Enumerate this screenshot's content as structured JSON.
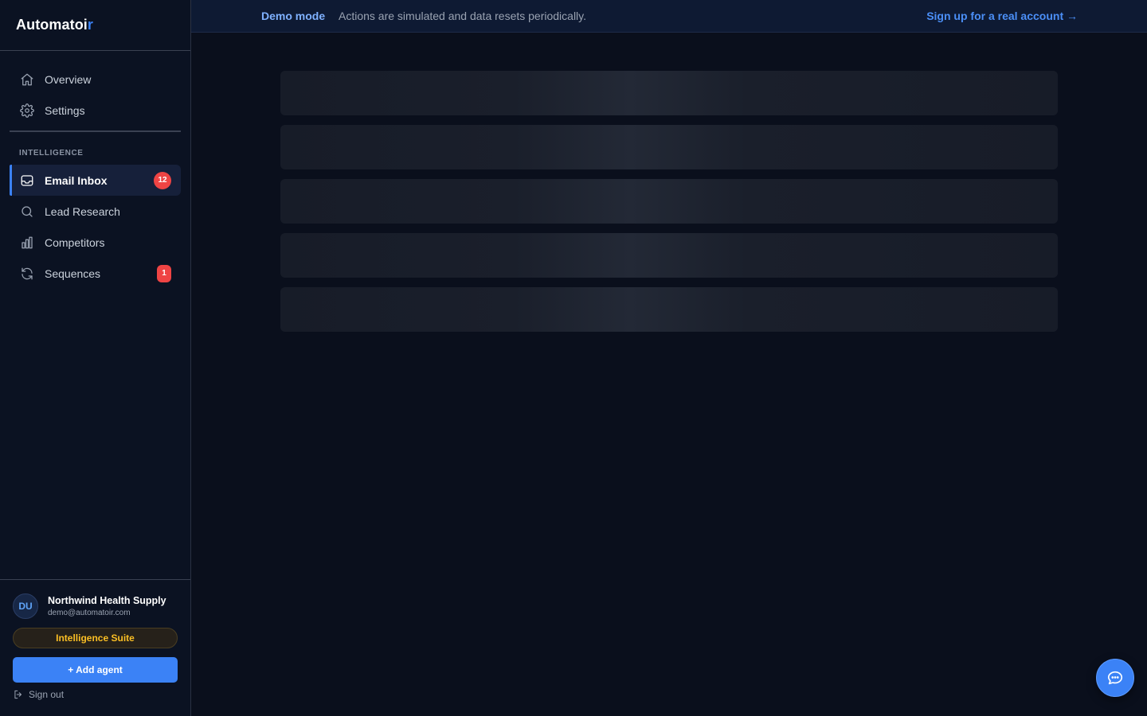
{
  "brand": {
    "name_main": "Automatoi",
    "name_accent": "r"
  },
  "banner": {
    "label": "Demo mode",
    "text": "Actions are simulated and data resets periodically.",
    "link": "Sign up for a real account →"
  },
  "nav": {
    "top": [
      {
        "label": "Overview",
        "icon": "home-icon"
      },
      {
        "label": "Settings",
        "icon": "gear-icon"
      }
    ],
    "section_label": "INTELLIGENCE",
    "section_items": [
      {
        "label": "Email Inbox",
        "icon": "inbox-icon",
        "badge": "12",
        "active": true
      },
      {
        "label": "Lead Research",
        "icon": "search-icon"
      },
      {
        "label": "Competitors",
        "icon": "bar-chart-icon"
      },
      {
        "label": "Sequences",
        "icon": "refresh-icon",
        "badge": "1"
      }
    ]
  },
  "account": {
    "initials": "DU",
    "name": "Northwind Health Supply",
    "email": "demo@automatoir.com",
    "plan": "Intelligence Suite",
    "add_agent": "+ Add agent",
    "sign_out": "Sign out"
  },
  "skeleton_count": 5,
  "colors": {
    "accent": "#3b82f6",
    "badge": "#ef4444",
    "plan": "#fbbf24",
    "background": "#0a0f1c"
  }
}
